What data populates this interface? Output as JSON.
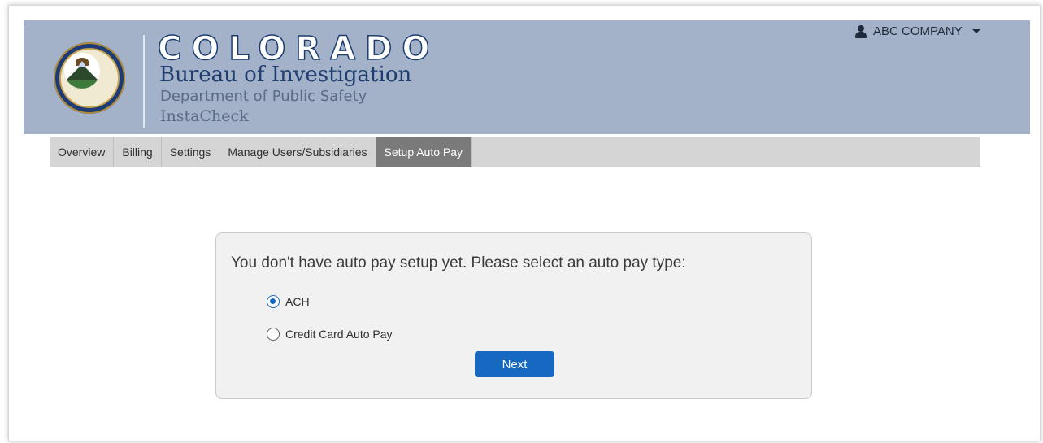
{
  "header": {
    "title_line1": "COLORADO",
    "title_line2": "Bureau of Investigation",
    "title_line3": "Department of Public Safety",
    "title_line4": "InstaCheck",
    "seal_icon": "colorado-bureau-of-investigation-seal",
    "user_icon": "person-icon",
    "company_label": "ABC COMPANY",
    "colors": {
      "header_bg": "#a3b2c8",
      "title_navy": "#1f3e6f"
    }
  },
  "nav": {
    "tabs": [
      {
        "label": "Overview"
      },
      {
        "label": "Billing"
      },
      {
        "label": "Settings"
      },
      {
        "label": "Manage Users/Subsidiaries"
      },
      {
        "label": "Setup Auto Pay"
      }
    ],
    "active": "Setup Auto Pay"
  },
  "panel": {
    "prompt": "You don't have auto pay setup yet. Please select an auto pay type:",
    "options": [
      {
        "label": "ACH",
        "selected": true
      },
      {
        "label": "Credit Card Auto Pay",
        "selected": false
      }
    ],
    "next_label": "Next",
    "accent_color": "#1768c0"
  }
}
